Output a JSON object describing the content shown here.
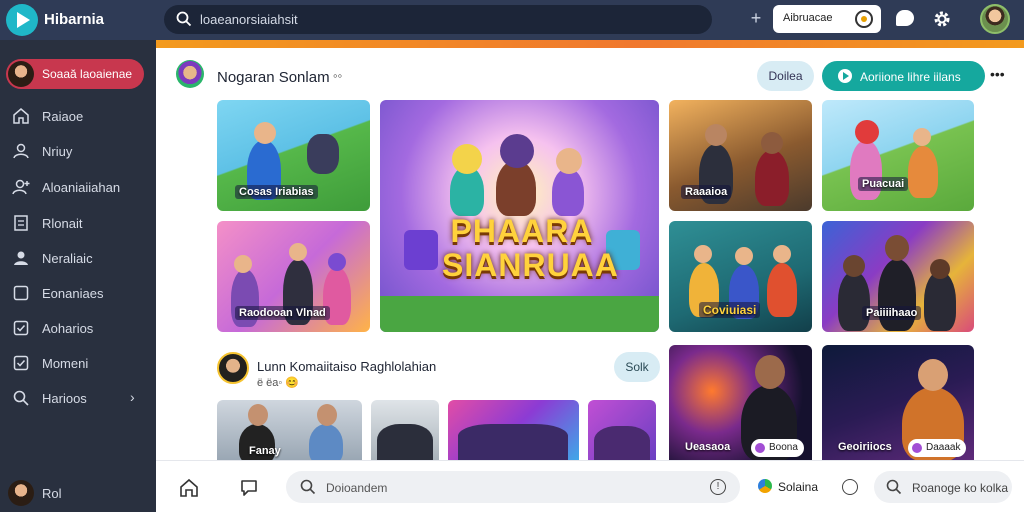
{
  "app": {
    "name": "Hibarnia"
  },
  "topbar": {
    "search_text": "loaeanorsiaiahsit",
    "pill_label": "Aibruacae"
  },
  "sidebar": {
    "user_label": "Soaaă laoaienae",
    "items": [
      {
        "label": "Raiaoe",
        "icon": "home-icon"
      },
      {
        "label": "Nriuy",
        "icon": "person-icon"
      },
      {
        "label": "Aloaniaiiahan",
        "icon": "person-add-icon"
      },
      {
        "label": "Rlonait",
        "icon": "document-icon"
      },
      {
        "label": "Neraliaic",
        "icon": "person-icon"
      },
      {
        "label": "Eonaniaes",
        "icon": "square-icon"
      },
      {
        "label": "Aoharios",
        "icon": "checkbox-icon"
      },
      {
        "label": "Momeni",
        "icon": "checkbox-icon"
      },
      {
        "label": "Harioos",
        "icon": "search-icon"
      }
    ],
    "bottom_label": "Rol"
  },
  "channel": {
    "title": "Nogaran Sonlam",
    "title_suffix": "◦◦",
    "ghost_button": "Doilea",
    "primary_button": "Aoriione lihre iilans"
  },
  "grid_cards": [
    {
      "caption": "Cosas Iriabias"
    },
    {
      "caption": "Phaara Sianrua"
    },
    {
      "caption": "Raaaioa"
    },
    {
      "caption": "Puacuai"
    },
    {
      "caption": "Raodooan Vlnad"
    },
    {
      "caption": "Coviuiasi"
    },
    {
      "caption": "Paiiiihaao"
    }
  ],
  "hero": {
    "title_line1": "PHAARA",
    "title_line2": "SIANRUAA"
  },
  "section2": {
    "title": "Lunn Komaiitaiso Raghlolahian",
    "subtitle": "ë ëa◦ 😊",
    "button": "Solk",
    "cards": [
      {
        "caption": "Fanay"
      },
      {
        "caption": ""
      },
      {
        "caption": ""
      },
      {
        "caption": ""
      }
    ],
    "tall_cards": [
      {
        "caption": "Ueasaoa",
        "pill": "Boona"
      },
      {
        "caption": "Geoiriiocs",
        "pill": "Daaaak"
      }
    ]
  },
  "bottombar": {
    "search_placeholder": "Doioandem",
    "status_label": "Solaina",
    "action_label": "Roanoge ko kolka"
  },
  "colors": {
    "topbar_bg": "#2f3b56",
    "sidebar_bg": "#29303f",
    "accent_teal": "#15a89e",
    "accent_orange": "#f39a1e",
    "user_pill_red": "#c8374e"
  }
}
